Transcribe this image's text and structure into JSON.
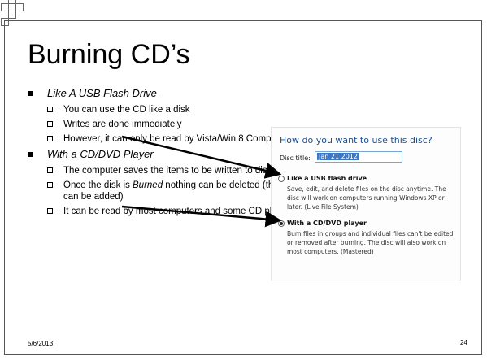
{
  "slide": {
    "title": "Burning CD’s",
    "date": "5/6/2013",
    "page_number": "24"
  },
  "bullets": [
    {
      "text": "Like A USB Flash Drive",
      "subs": [
        "You can use the CD like a disk",
        "Writes are done immediately",
        "However, it can only be read by Vista/Win 8 Computers"
      ]
    },
    {
      "text": "With a CD/DVD Player",
      "subs": [
        "The computer saves the items to be written to disk",
        "Once the disk is Burned nothing can be deleted (things can be added)",
        "It can be read by most computers and some CD players"
      ]
    }
  ],
  "dialog": {
    "heading": "How do you want to use this disc?",
    "disc_title_label": "Disc title:",
    "disc_title_value": "Jan 21 2012",
    "option1_title": "Like a USB flash drive",
    "option1_desc": "Save, edit, and delete files on the disc anytime. The disc will work on computers running Windows XP or later. (Live File System)",
    "option2_title": "With a CD/DVD player",
    "option2_desc": "Burn files in groups and individual files can't be edited or removed after burning. The disc will also work on most computers. (Mastered)"
  }
}
